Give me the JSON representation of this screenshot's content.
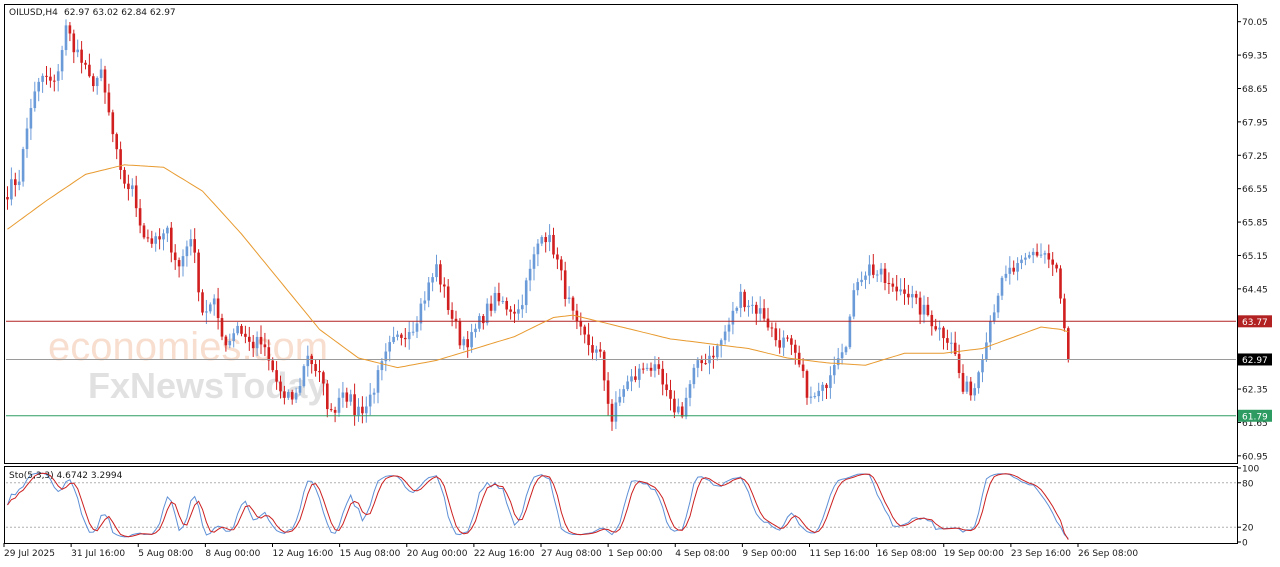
{
  "header": {
    "symbol": "OILUSD,H4",
    "ohlc": "62.97 63.02 62.84 62.97"
  },
  "watermark": {
    "logo_top": "economies.com",
    "logo_bottom": "FxNewsToday"
  },
  "colors": {
    "up": "#6a9ad8",
    "down": "#d11f1f",
    "ma": "#e89a2f",
    "resistance": "#b22222",
    "support": "#2e9c62",
    "current": "#9a9a9a",
    "stoch_main": "#5f90d6",
    "stoch_signal": "#cc2020"
  },
  "chart_data": [
    {
      "type": "candlestick",
      "symbol": "OILUSD",
      "timeframe": "H4",
      "y_ticks": [
        "70.05",
        "69.35",
        "68.65",
        "67.95",
        "67.25",
        "66.55",
        "65.85",
        "65.15",
        "64.45",
        "63.75",
        "62.35",
        "61.65",
        "60.95"
      ],
      "ylim": [
        60.8,
        70.4
      ],
      "x_ticks": [
        "29 Jul 2025",
        "31 Jul 16:00",
        "5 Aug 08:00",
        "8 Aug 00:00",
        "12 Aug 16:00",
        "15 Aug 08:00",
        "20 Aug 00:00",
        "22 Aug 16:00",
        "27 Aug 08:00",
        "1 Sep 00:00",
        "4 Sep 08:00",
        "9 Sep 00:00",
        "11 Sep 16:00",
        "16 Sep 08:00",
        "19 Sep 00:00",
        "23 Sep 16:00",
        "26 Sep 08:00"
      ],
      "price_anchors": [
        [
          0,
          66.5
        ],
        [
          3,
          66.8
        ],
        [
          6,
          68.3
        ],
        [
          9,
          68.9
        ],
        [
          12,
          68.7
        ],
        [
          15,
          69.9
        ],
        [
          18,
          69.4
        ],
        [
          21,
          68.8
        ],
        [
          24,
          68.9
        ],
        [
          26,
          68.1
        ],
        [
          29,
          66.8
        ],
        [
          32,
          66.5
        ],
        [
          35,
          65.6
        ],
        [
          38,
          65.4
        ],
        [
          41,
          65.6
        ],
        [
          44,
          64.9
        ],
        [
          47,
          65.6
        ],
        [
          50,
          64.0
        ],
        [
          53,
          64.1
        ],
        [
          56,
          63.3
        ],
        [
          59,
          63.7
        ],
        [
          62,
          63.3
        ],
        [
          65,
          63.3
        ],
        [
          68,
          62.7
        ],
        [
          71,
          62.1
        ],
        [
          74,
          62.2
        ],
        [
          77,
          63.1
        ],
        [
          80,
          62.6
        ],
        [
          83,
          61.8
        ],
        [
          86,
          62.4
        ],
        [
          89,
          61.9
        ],
        [
          92,
          62.0
        ],
        [
          95,
          62.6
        ],
        [
          98,
          63.2
        ],
        [
          101,
          63.5
        ],
        [
          104,
          63.7
        ],
        [
          107,
          64.3
        ],
        [
          110,
          64.9
        ],
        [
          113,
          64.1
        ],
        [
          116,
          63.4
        ],
        [
          119,
          63.4
        ],
        [
          122,
          63.9
        ],
        [
          125,
          64.2
        ],
        [
          128,
          64.1
        ],
        [
          131,
          64.0
        ],
        [
          134,
          64.8
        ],
        [
          137,
          65.7
        ],
        [
          140,
          65.3
        ],
        [
          143,
          64.4
        ],
        [
          146,
          63.6
        ],
        [
          149,
          63.3
        ],
        [
          152,
          63.0
        ],
        [
          155,
          61.7
        ],
        [
          158,
          62.4
        ],
        [
          161,
          62.6
        ],
        [
          164,
          62.9
        ],
        [
          167,
          62.6
        ],
        [
          170,
          62.0
        ],
        [
          173,
          61.9
        ],
        [
          176,
          62.7
        ],
        [
          179,
          63.0
        ],
        [
          182,
          63.2
        ],
        [
          185,
          63.7
        ],
        [
          188,
          64.3
        ],
        [
          191,
          64.1
        ],
        [
          194,
          63.9
        ],
        [
          197,
          63.4
        ],
        [
          200,
          63.3
        ],
        [
          203,
          62.8
        ],
        [
          206,
          62.1
        ],
        [
          209,
          62.3
        ],
        [
          212,
          63.0
        ],
        [
          215,
          63.4
        ],
        [
          218,
          64.7
        ],
        [
          221,
          64.9
        ],
        [
          224,
          64.7
        ],
        [
          227,
          64.4
        ],
        [
          230,
          64.5
        ],
        [
          233,
          64.1
        ],
        [
          236,
          63.9
        ],
        [
          239,
          63.6
        ],
        [
          242,
          63.4
        ],
        [
          245,
          62.3
        ],
        [
          248,
          62.4
        ],
        [
          251,
          63.5
        ],
        [
          254,
          64.4
        ],
        [
          257,
          64.8
        ],
        [
          260,
          64.9
        ],
        [
          263,
          65.2
        ],
        [
          266,
          65.2
        ],
        [
          269,
          64.8
        ],
        [
          272,
          62.97
        ]
      ],
      "bar_count": 273,
      "last_close": 62.97,
      "moving_average": {
        "anchors": [
          [
            0,
            65.7
          ],
          [
            10,
            66.3
          ],
          [
            20,
            66.85
          ],
          [
            30,
            67.05
          ],
          [
            40,
            67.0
          ],
          [
            50,
            66.5
          ],
          [
            60,
            65.6
          ],
          [
            70,
            64.6
          ],
          [
            80,
            63.6
          ],
          [
            90,
            63.0
          ],
          [
            100,
            62.8
          ],
          [
            110,
            62.95
          ],
          [
            120,
            63.2
          ],
          [
            130,
            63.45
          ],
          [
            140,
            63.85
          ],
          [
            145,
            63.9
          ],
          [
            150,
            63.8
          ],
          [
            160,
            63.6
          ],
          [
            170,
            63.4
          ],
          [
            180,
            63.3
          ],
          [
            190,
            63.2
          ],
          [
            200,
            63.0
          ],
          [
            210,
            62.9
          ],
          [
            220,
            62.85
          ],
          [
            230,
            63.1
          ],
          [
            240,
            63.1
          ],
          [
            250,
            63.2
          ],
          [
            260,
            63.5
          ],
          [
            265,
            63.65
          ],
          [
            270,
            63.6
          ],
          [
            272,
            63.55
          ]
        ],
        "direction": "smooth"
      },
      "levels": [
        {
          "name": "resistance",
          "value": 63.77,
          "label": "63.77"
        },
        {
          "name": "current",
          "value": 62.97,
          "label": "62.97"
        },
        {
          "name": "support",
          "value": 61.79,
          "label": "61.79"
        }
      ]
    },
    {
      "type": "line",
      "title": "Sto(5,3,3) 4.6742 3.2994",
      "indicator": "Stochastic",
      "ylim": [
        0,
        100
      ],
      "y_ticks": [
        "100",
        "80",
        "20",
        "0"
      ],
      "reference_lines": [
        80,
        20
      ],
      "series": [
        {
          "name": "main",
          "value": 4.6742
        },
        {
          "name": "signal",
          "value": 3.2994
        }
      ]
    }
  ]
}
